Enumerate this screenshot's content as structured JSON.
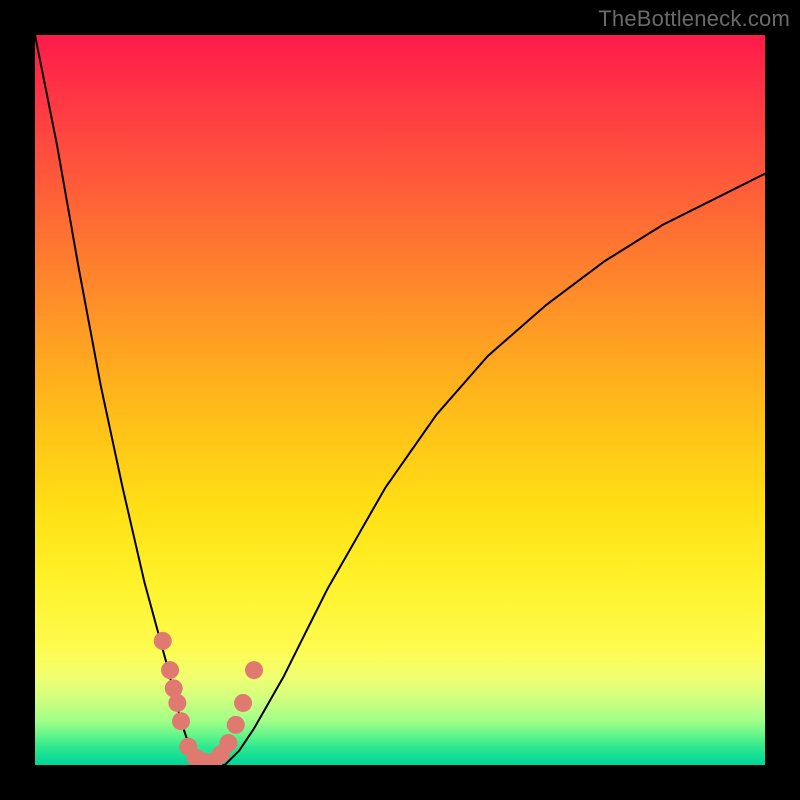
{
  "watermark": "TheBottleneck.com",
  "chart_data": {
    "type": "line",
    "title": "",
    "xlabel": "",
    "ylabel": "",
    "xlim": [
      0,
      100
    ],
    "ylim": [
      0,
      100
    ],
    "grid": false,
    "series": [
      {
        "name": "curve",
        "x": [
          0,
          3,
          6,
          9,
          12,
          15,
          18,
          19,
          20,
          21,
          22,
          23,
          24,
          26,
          28,
          30,
          34,
          40,
          48,
          55,
          62,
          70,
          78,
          86,
          94,
          100
        ],
        "values": [
          100,
          85,
          68,
          52,
          38,
          25,
          14,
          10,
          6,
          3,
          1,
          0,
          0,
          0,
          2,
          5,
          12,
          24,
          38,
          48,
          56,
          63,
          69,
          74,
          78,
          81
        ]
      }
    ],
    "markers": {
      "name": "dots",
      "color": "#e07a70",
      "x": [
        17.5,
        18.5,
        19.0,
        19.5,
        20.0,
        21.0,
        22.0,
        23.0,
        24.5,
        25.5,
        26.5,
        27.5,
        28.5,
        30.0
      ],
      "values": [
        17,
        13,
        10.5,
        8.5,
        6.0,
        2.5,
        1.0,
        0.5,
        0.5,
        1.5,
        3.0,
        5.5,
        8.5,
        13.0
      ]
    },
    "background_gradient": {
      "stops": [
        {
          "pos": 0.0,
          "color": "#ff1a4a"
        },
        {
          "pos": 0.2,
          "color": "#ff5a3a"
        },
        {
          "pos": 0.5,
          "color": "#ffb81a"
        },
        {
          "pos": 0.75,
          "color": "#fff22a"
        },
        {
          "pos": 0.92,
          "color": "#a0ff88"
        },
        {
          "pos": 1.0,
          "color": "#00d698"
        }
      ]
    }
  }
}
